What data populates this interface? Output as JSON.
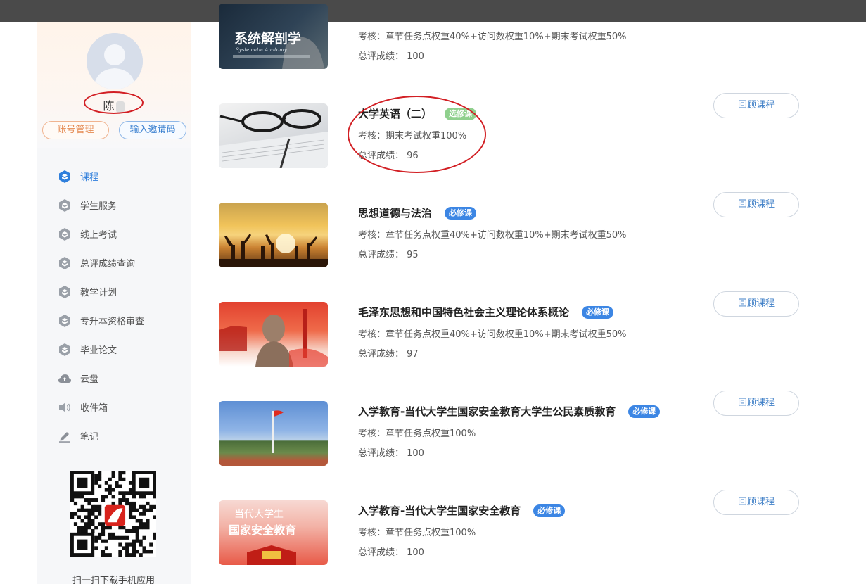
{
  "profile": {
    "name": "陈",
    "account_btn": "账号管理",
    "invite_btn": "输入邀请码"
  },
  "nav": [
    {
      "label": "课程",
      "icon": "course-cube-icon",
      "active": true
    },
    {
      "label": "学生服务",
      "icon": "cube-icon"
    },
    {
      "label": "线上考试",
      "icon": "cube-icon"
    },
    {
      "label": "总评成绩查询",
      "icon": "cube-icon"
    },
    {
      "label": "教学计划",
      "icon": "cube-icon"
    },
    {
      "label": "专升本资格审查",
      "icon": "cube-icon"
    },
    {
      "label": "毕业论文",
      "icon": "cube-icon"
    },
    {
      "label": "云盘",
      "icon": "cloud-icon"
    },
    {
      "label": "收件箱",
      "icon": "speaker-icon"
    },
    {
      "label": "笔记",
      "icon": "pen-icon"
    }
  ],
  "qr_caption": "扫一扫下载手机应用",
  "partial_course": {
    "thumb_text": "系统解剖学",
    "thumb_subtext": "Systematic Anatomy",
    "assess": "考核：章节任务点权重40%+访问数权重10%+期末考试权重50%",
    "score": "总评成绩： 100"
  },
  "review_label": "回顾课程",
  "courses": [
    {
      "title": "大学英语（二）",
      "tag": "选修课",
      "tag_type": "elective",
      "assess": "考核：期末考试权重100%",
      "score": "总评成绩： 96",
      "thumb": "glasses"
    },
    {
      "title": "思想道德与法治",
      "tag": "必修课",
      "tag_type": "required",
      "assess": "考核：章节任务点权重40%+访问数权重10%+期末考试权重50%",
      "score": "总评成绩： 95",
      "thumb": "sunset"
    },
    {
      "title": "毛泽东思想和中国特色社会主义理论体系概论",
      "tag": "必修课",
      "tag_type": "required",
      "assess": "考核：章节任务点权重40%+访问数权重10%+期末考试权重50%",
      "score": "总评成绩： 97",
      "thumb": "statue"
    },
    {
      "title": "入学教育-当代大学生国家安全教育大学生公民素质教育",
      "tag": "必修课",
      "tag_type": "required",
      "assess": "考核：章节任务点权重100%",
      "score": "总评成绩： 100",
      "thumb": "flag"
    },
    {
      "title": "入学教育-当代大学生国家安全教育",
      "tag": "必修课",
      "tag_type": "required",
      "assess": "考核：章节任务点权重100%",
      "score": "总评成绩： 100",
      "thumb": "poster",
      "thumb_text_1": "当代大学生",
      "thumb_text_2": "国家安全教育"
    }
  ],
  "colors": {
    "accent": "#2f7fdc",
    "required_tag": "#3c86e4",
    "elective_tag": "#8fd08d",
    "annotation": "#d21f24"
  }
}
